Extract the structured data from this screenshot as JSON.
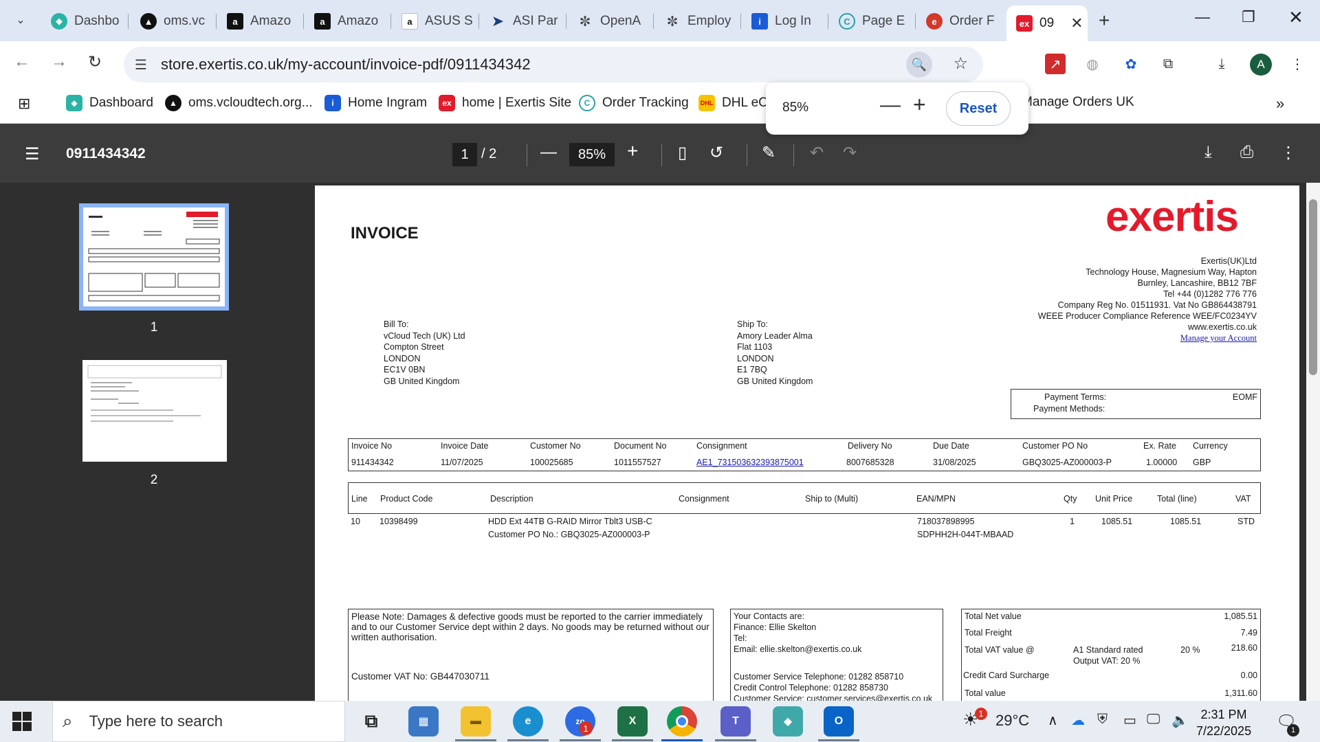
{
  "browser": {
    "tabs": [
      {
        "label": "Dashbo",
        "icon": "dashboard-icon",
        "color": "#2bb3a6"
      },
      {
        "label": "oms.vc",
        "icon": "oms-icon",
        "color": "#111111"
      },
      {
        "label": "Amazo",
        "icon": "amazon-icon",
        "color": "#111111"
      },
      {
        "label": "Amazo",
        "icon": "amazon-icon",
        "color": "#111111"
      },
      {
        "label": "ASUS S",
        "icon": "amazon-icon",
        "color": "#ffffff"
      },
      {
        "label": "ASI Par",
        "icon": "asi-icon",
        "color": "#1b3f7a"
      },
      {
        "label": "OpenA",
        "icon": "openai-icon",
        "color": "#444444"
      },
      {
        "label": "Employ",
        "icon": "openai-icon",
        "color": "#444444"
      },
      {
        "label": "Log In",
        "icon": "ingram-icon",
        "color": "#1a5bd6"
      },
      {
        "label": "Page E",
        "icon": "tracking-icon",
        "color": "#27a0a6"
      },
      {
        "label": "Order F",
        "icon": "order-icon",
        "color": "#d23a2a"
      },
      {
        "label": "09",
        "icon": "exertis-icon",
        "color": "#e31a2b",
        "active": true
      }
    ],
    "url": "store.exertis.co.uk/my-account/invoice-pdf/0911434342",
    "avatar_letter": "A",
    "bookmarks": [
      {
        "label": "Dashboard",
        "color": "#2bb3a6"
      },
      {
        "label": "oms.vcloudtech.org...",
        "color": "#111111"
      },
      {
        "label": "Home Ingram",
        "color": "#1a5bd6"
      },
      {
        "label": "home | Exertis Site",
        "color": "#e31a2b"
      },
      {
        "label": "Order Tracking",
        "color": "#27a0a6"
      },
      {
        "label": "DHL eCo",
        "color": "#f5c400"
      },
      {
        "label": "Manage Orders UK",
        "color": "#111111"
      }
    ],
    "zoom_popup": {
      "percent": "85%",
      "reset_label": "Reset"
    }
  },
  "pdf": {
    "title": "0911434342",
    "current_page": "1",
    "page_total": "/ 2",
    "zoom": "85%",
    "thumbnails": [
      "1",
      "2"
    ]
  },
  "invoice": {
    "heading": "INVOICE",
    "logo_text": "exertis",
    "company": [
      "Exertis(UK)Ltd",
      "Technology House, Magnesium Way, Hapton",
      "Burnley, Lancashire, BB12 7BF",
      "Tel +44 (0)1282 776 776",
      "Company Reg No. 01511931. Vat No GB864438791",
      "WEEE Producer Compliance Reference WEE/FC0234YV",
      "www.exertis.co.uk"
    ],
    "manage_link": "Manage your Account",
    "bill_to": [
      "Bill To:",
      "vCloud Tech (UK) Ltd",
      "Compton Street",
      "LONDON",
      "EC1V 0BN",
      "GB United Kingdom"
    ],
    "ship_to": [
      "Ship To:",
      "Amory Leader Alma",
      "Flat 1103",
      "LONDON",
      "E1 7BQ",
      "GB United Kingdom"
    ],
    "payment_terms_label": "Payment Terms:",
    "payment_terms_value": "EOMF",
    "payment_methods_label": "Payment Methods:",
    "header_labels": [
      "Invoice No",
      "Invoice Date",
      "Customer No",
      "Document No",
      "Consignment",
      "Delivery No",
      "Due Date",
      "Customer PO No",
      "Ex. Rate",
      "Currency"
    ],
    "header_values": [
      "911434342",
      "11/07/2025",
      "100025685",
      "1011557527",
      "AE1_731503632393875001",
      "8007685328",
      "31/08/2025",
      "GBQ3025-AZ000003-P",
      "1.00000",
      "GBP"
    ],
    "line_headers": [
      "Line",
      "Product Code",
      "Description",
      "Consignment",
      "Ship to (Multi)",
      "EAN/MPN",
      "Qty",
      "Unit Price",
      "Total (line)",
      "VAT"
    ],
    "line": {
      "line": "10",
      "product_code": "10398499",
      "description": "HDD Ext 44TB G-RAID Mirror Tblt3 USB-C",
      "po_note": "Customer PO No.: GBQ3025-AZ000003-P",
      "ean": "718037898995",
      "mpn": "SDPHH2H-044T-MBAAD",
      "qty": "1",
      "unit_price": "1085.51",
      "total": "1085.51",
      "vat": "STD"
    },
    "note": "Please Note: Damages & defective goods must be reported to the carrier immediately and to our Customer Service dept within 2 days. No goods may be returned without our written authorisation.",
    "customer_vat": "Customer VAT No: GB447030711",
    "contacts": [
      "Your Contacts are:",
      "Finance: Ellie Skelton",
      "Tel:",
      "Email: ellie.skelton@exertis.co.uk",
      "",
      "Customer Service Telephone:  01282 858710",
      "Credit Control Telephone:  01282 858730",
      "Customer Service:  customer.services@exertis.co.uk"
    ],
    "totals": {
      "net_label": "Total Net value",
      "net": "1,085.51",
      "freight_label": "Total Freight",
      "freight": "7.49",
      "vat_label": "Total VAT value @",
      "vat_desc1": "A1 Standard rated",
      "vat_desc2": "Output VAT: 20 %",
      "vat_rate": "20 %",
      "vat": "218.60",
      "cc_label": "Credit Card Surcharge",
      "cc": "0.00",
      "total_label": "Total value",
      "total": "1,311.60"
    }
  },
  "taskbar": {
    "search_placeholder": "Type here to search",
    "weather": "29°C",
    "time": "2:31 PM",
    "date": "7/22/2025",
    "zoom_badge": "1",
    "weather_badge": "1",
    "notif_badge": "1"
  }
}
